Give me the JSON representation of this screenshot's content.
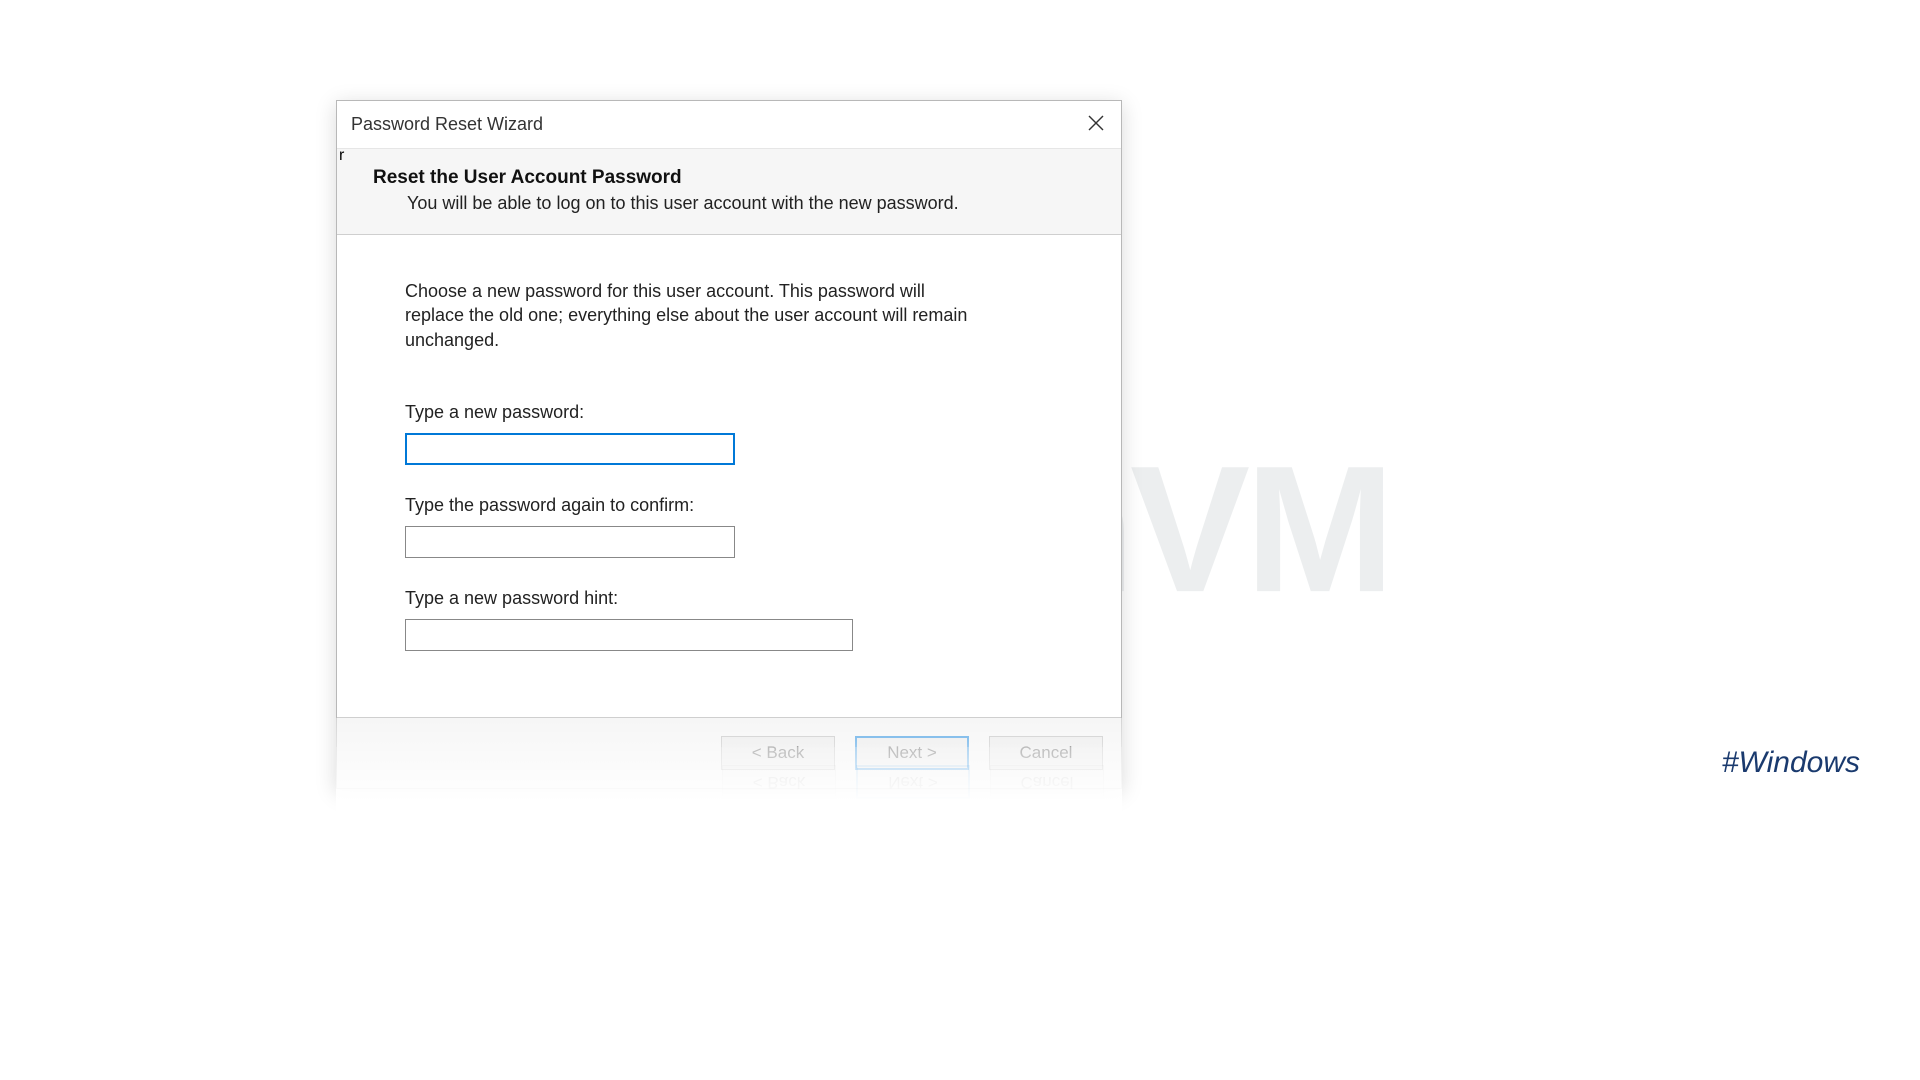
{
  "watermark": "NeuronVM",
  "hashtag": "#Windows",
  "dialog": {
    "title": "Password Reset Wizard",
    "header": {
      "title": "Reset the User Account Password",
      "subtitle": "You will be able to log on to this user account with the new password."
    },
    "instruction": "Choose a new password for this user account. This password will replace the old one; everything else about the user account will remain unchanged.",
    "fields": {
      "new_password": {
        "label": "Type a new password:",
        "value": ""
      },
      "confirm_password": {
        "label": "Type the password again to confirm:",
        "value": ""
      },
      "hint": {
        "label": "Type a new password hint:",
        "value": ""
      }
    },
    "buttons": {
      "back": "< Back",
      "next": "Next >",
      "cancel": "Cancel"
    }
  }
}
